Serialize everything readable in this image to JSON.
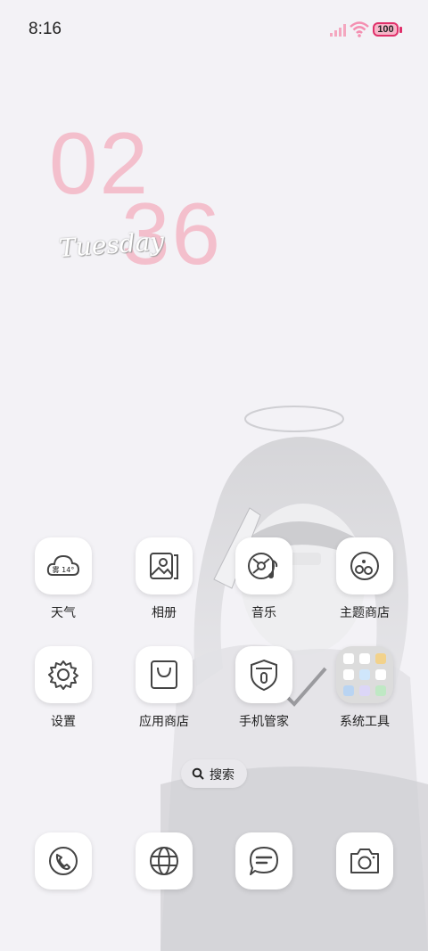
{
  "status_bar": {
    "time": "8:16",
    "battery": "100"
  },
  "clock": {
    "hours": "02",
    "minutes": "36",
    "day": "Tuesday"
  },
  "apps_row1": [
    {
      "label": "天气",
      "icon": "weather-icon",
      "weather_text": "雾 14°"
    },
    {
      "label": "相册",
      "icon": "gallery-icon"
    },
    {
      "label": "音乐",
      "icon": "music-icon"
    },
    {
      "label": "主题商店",
      "icon": "theme-store-icon"
    }
  ],
  "apps_row2": [
    {
      "label": "设置",
      "icon": "gear-icon"
    },
    {
      "label": "应用商店",
      "icon": "app-store-icon"
    },
    {
      "label": "手机管家",
      "icon": "shield-icon"
    },
    {
      "label": "系统工具",
      "icon": "folder-icon"
    }
  ],
  "search": {
    "label": "搜索"
  },
  "dock": [
    {
      "icon": "phone-icon"
    },
    {
      "icon": "browser-icon"
    },
    {
      "icon": "message-icon"
    },
    {
      "icon": "camera-icon"
    }
  ],
  "colors": {
    "clock": "#f3bfcc",
    "battery": "#e0306a",
    "background": "#f3f2f6"
  }
}
